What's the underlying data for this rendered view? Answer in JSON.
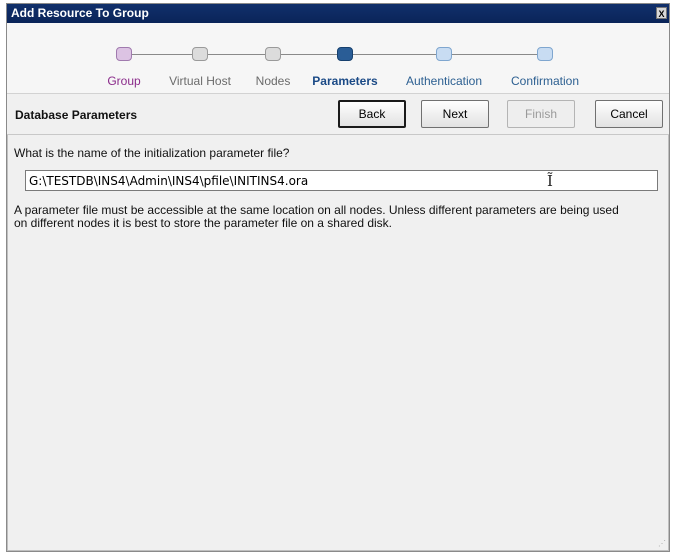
{
  "window": {
    "title": "Add Resource To Group",
    "close_label": "X"
  },
  "wizard": {
    "steps": [
      {
        "label": "Group",
        "state": "visited",
        "color": "#8b2b8b",
        "node_color": "#dcc3e3"
      },
      {
        "label": "Virtual Host",
        "state": "pending",
        "color": "#6b6b6b",
        "node_color": "#dcdcdc"
      },
      {
        "label": "Nodes",
        "state": "pending",
        "color": "#6b6b6b",
        "node_color": "#dcdcdc"
      },
      {
        "label": "Parameters",
        "state": "current",
        "color": "#1b4a86",
        "node_color": "#2a5d96"
      },
      {
        "label": "Authentication",
        "state": "upcoming",
        "color": "#2c5f91",
        "node_color": "#c8dcf2"
      },
      {
        "label": "Confirmation",
        "state": "upcoming",
        "color": "#2c5f91",
        "node_color": "#c8dcf2"
      }
    ]
  },
  "toolbar": {
    "title": "Database Parameters",
    "back_label": "Back",
    "next_label": "Next",
    "finish_label": "Finish",
    "cancel_label": "Cancel"
  },
  "form": {
    "question": "What is the name of the initialization parameter file?",
    "pfile_value": "G:\\TESTDB\\INS4\\Admin\\INS4\\pfile\\INITINS4.ora",
    "help_text": "A parameter file must be accessible at the same location on all nodes.  Unless different parameters are being used on different nodes it is best to store the parameter file on a shared disk."
  },
  "icons": {
    "text_cursor": "text-cursor-icon",
    "resize_grip": "resize-grip-icon"
  }
}
